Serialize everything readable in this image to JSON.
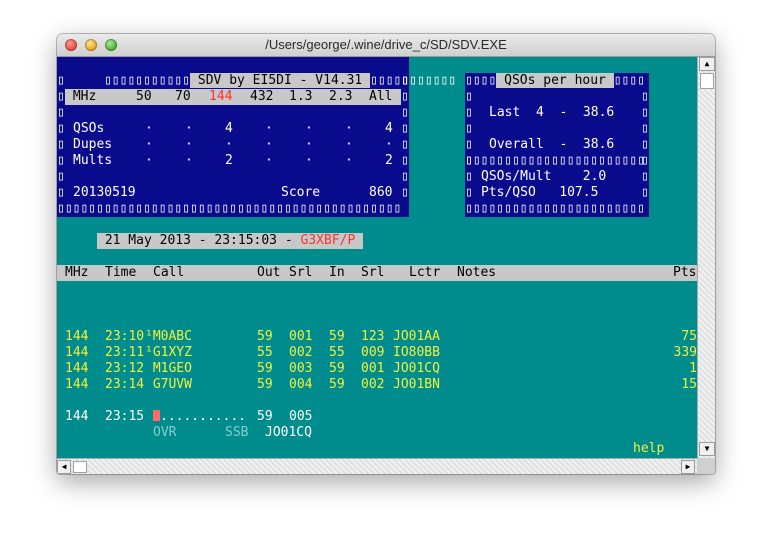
{
  "window": {
    "title": "/Users/george/.wine/drive_c/SD/SDV.EXE"
  },
  "box_char": "▯",
  "panel": {
    "title": " SDV by EI5DI - V14.31 ",
    "bands_row": [
      " MHz",
      "50",
      "70",
      "144",
      "432",
      "1.3",
      "2.3",
      "All"
    ],
    "rows": [
      {
        "label": "QSOs",
        "values": [
          "·",
          "·",
          "4",
          "·",
          "·",
          "·",
          "4"
        ]
      },
      {
        "label": "Dupes",
        "values": [
          "·",
          "·",
          "·",
          "·",
          "·",
          "·",
          "·"
        ]
      },
      {
        "label": "Mults",
        "values": [
          "·",
          "·",
          "2",
          "·",
          "·",
          "·",
          "2"
        ]
      }
    ],
    "date": "20130519",
    "score_label": "Score",
    "score_value": "860"
  },
  "rate_panel": {
    "title": " QSOs per hour ",
    "last": "Last  4  -  38.6",
    "overall": "Overall  -  38.6",
    "qsos_mult": "QSOs/Mult    2.0",
    "pts_qso": "Pts/QSO   107.5"
  },
  "datebar": {
    "text": " 21 May 2013 - 23:15:03 - ",
    "callsign": "G3XBF/P "
  },
  "log": {
    "headers": [
      "MHz",
      "Time",
      "Call",
      "Out",
      "Srl",
      "In",
      "Srl",
      "Lctr",
      "Notes",
      "Pts"
    ],
    "rows": [
      {
        "mhz": "144",
        "time": "23:10",
        "call": "¹M0ABC",
        "out": "59",
        "srl_out": "001",
        "in": "59",
        "srl_in": "123",
        "loc": "JO01AA",
        "pts": "75"
      },
      {
        "mhz": "144",
        "time": "23:11",
        "call": "¹G1XYZ",
        "out": "55",
        "srl_out": "002",
        "in": "55",
        "srl_in": "009",
        "loc": "IO80BB",
        "pts": "339"
      },
      {
        "mhz": "144",
        "time": "23:12",
        "call": " M1GEO",
        "out": "59",
        "srl_out": "003",
        "in": "59",
        "srl_in": "001",
        "loc": "JO01CQ",
        "pts": "1"
      },
      {
        "mhz": "144",
        "time": "23:14",
        "call": " G7UVW",
        "out": "59",
        "srl_out": "004",
        "in": "59",
        "srl_in": "002",
        "loc": "JO01BN",
        "pts": "15"
      }
    ],
    "entry": {
      "mhz": "144",
      "time": "23:15",
      "dots": "...........",
      "out": "59",
      "srl_out": "005"
    },
    "status": {
      "ovr": "OVR",
      "mode": "SSB",
      "locator": "JO01CQ"
    },
    "help": "help"
  },
  "colors": {
    "background": "#008c8c",
    "panel": "#0a0a8c",
    "log_text": "#f2f23c",
    "highlight": "#ff3030"
  }
}
